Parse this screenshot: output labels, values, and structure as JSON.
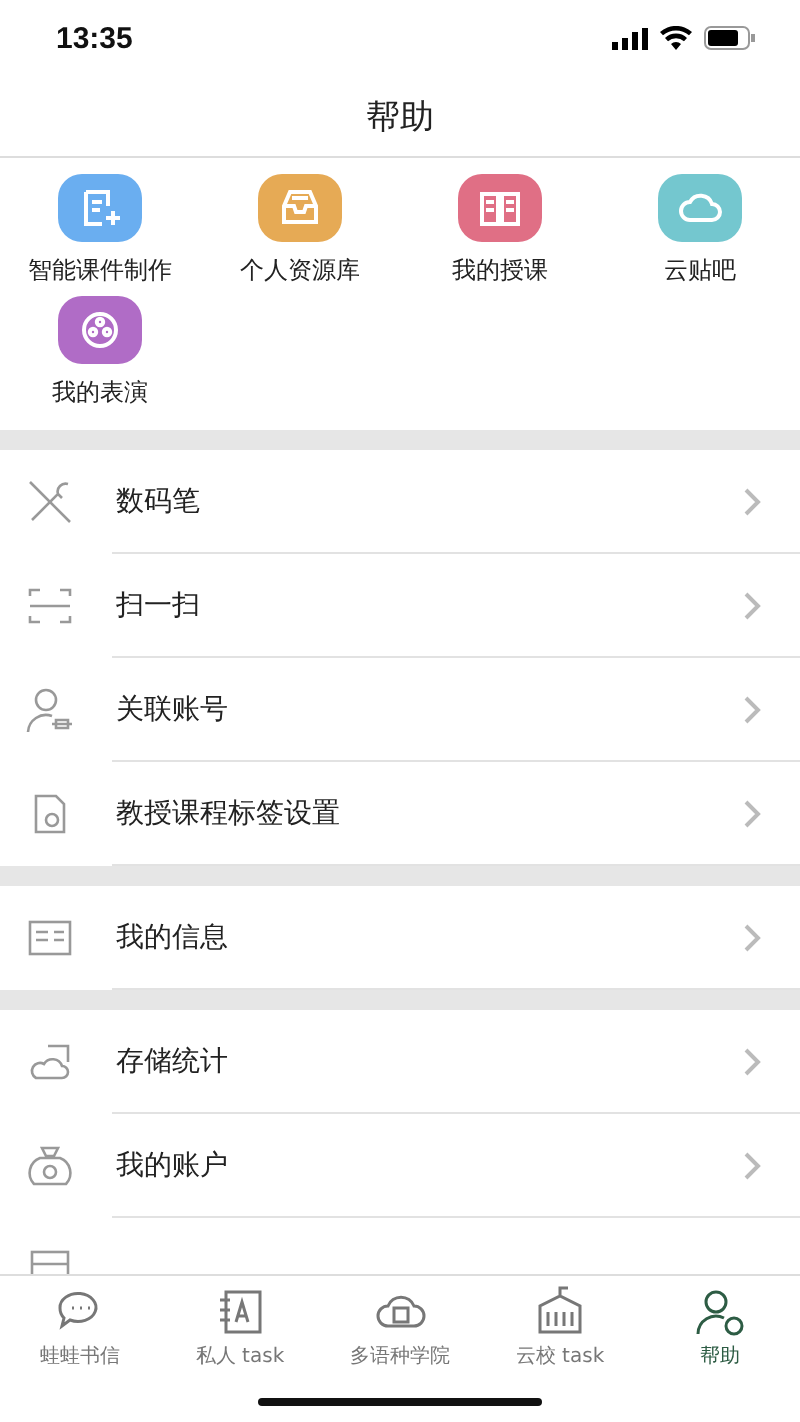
{
  "status_bar": {
    "time": "13:35"
  },
  "title": "帮助",
  "shortcuts": [
    {
      "label": "智能课件制作",
      "kind": "courseware",
      "color": "#6aaef0"
    },
    {
      "label": "个人资源库",
      "kind": "inbox",
      "color": "#e6aa55"
    },
    {
      "label": "我的授课",
      "kind": "book",
      "color": "#e06f85"
    },
    {
      "label": "云贴吧",
      "kind": "cloud",
      "color": "#74c7cf"
    },
    {
      "label": "我的表演",
      "kind": "film",
      "color": "#b06cc6"
    }
  ],
  "sections": [
    [
      {
        "label": "数码笔",
        "kind": "tools"
      },
      {
        "label": "扫一扫",
        "kind": "scan"
      },
      {
        "label": "关联账号",
        "kind": "user-link"
      },
      {
        "label": "教授课程标签设置",
        "kind": "tag"
      }
    ],
    [
      {
        "label": "我的信息",
        "kind": "info"
      }
    ],
    [
      {
        "label": "存储统计",
        "kind": "storage"
      },
      {
        "label": "我的账户",
        "kind": "moneybag"
      },
      {
        "kind": "list"
      }
    ]
  ],
  "tabs": [
    {
      "label": "蛙蛙书信",
      "kind": "chat",
      "selected": false
    },
    {
      "label": "私人 task",
      "kind": "notebook",
      "selected": false
    },
    {
      "label": "多语种学院",
      "kind": "cloud-box",
      "selected": false
    },
    {
      "label": "云校 task",
      "kind": "school",
      "selected": false
    },
    {
      "label": "帮助",
      "kind": "user-help",
      "selected": true
    }
  ]
}
